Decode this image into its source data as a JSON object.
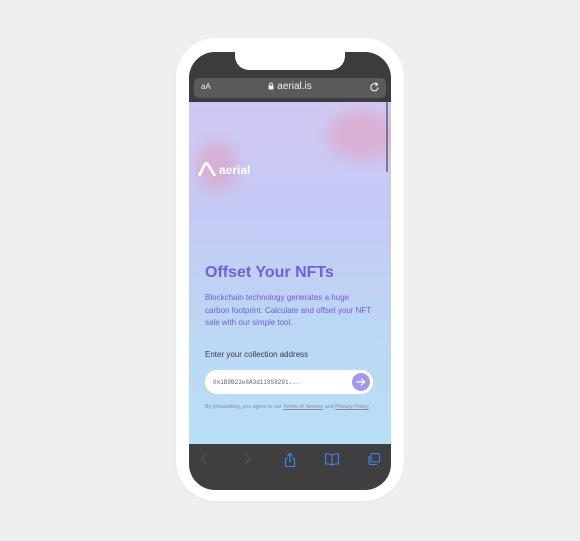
{
  "browser": {
    "text_size_label": "aA",
    "url": "aerial.is"
  },
  "brand": {
    "name": "aerial"
  },
  "hero": {
    "title": "Offset Your NFTs",
    "description": "Blockchain technology generates a huge carbon footprint. Calculate and offset your NFT sale with our simple tool."
  },
  "form": {
    "label": "Enter your collection address",
    "placeholder": "0x1B9B23e8A3d11858291..."
  },
  "legal": {
    "prefix": "By proceeding, you agree to our",
    "terms": "Terms of Service",
    "and": "and",
    "privacy": "Privacy Policy"
  },
  "colors": {
    "accent": "#6f60dc",
    "button": "#a596ec"
  },
  "icons": {
    "lock": "lock-icon",
    "reload": "reload-icon",
    "back": "back-arrow-icon",
    "forward": "forward-arrow-icon",
    "share": "share-icon",
    "bookmarks": "bookmarks-icon",
    "tabs": "tabs-icon",
    "submit": "arrow-right-icon"
  }
}
